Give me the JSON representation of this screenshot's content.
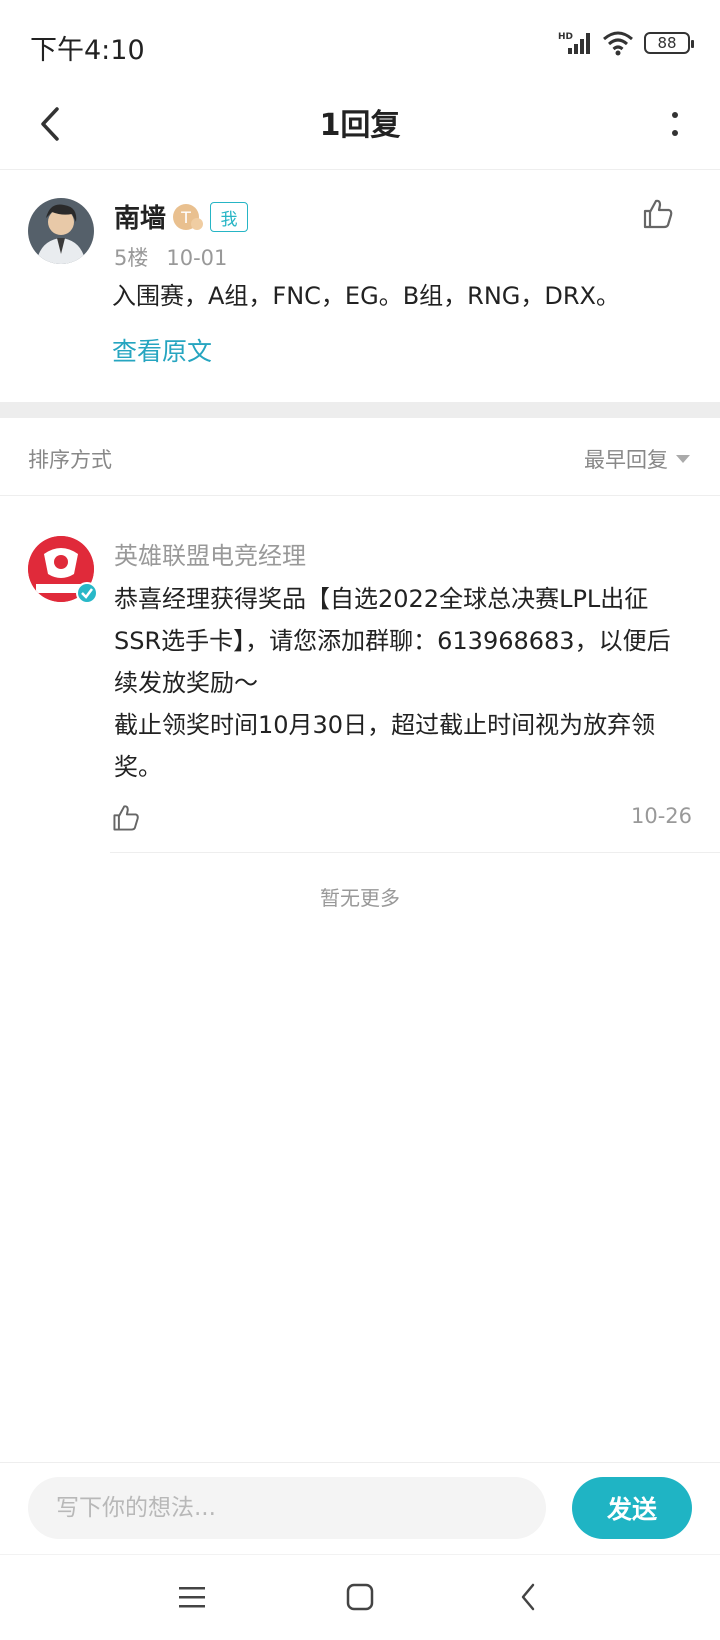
{
  "status_bar": {
    "time": "下午4:10",
    "network_label": "HD",
    "battery": "88"
  },
  "header": {
    "title": "1回复"
  },
  "post": {
    "author": "南墙",
    "level_badge": "T",
    "me_badge": "我",
    "floor": "5楼",
    "date": "10-01",
    "content": "入围赛，A组，FNC，EG。B组，RNG，DRX。",
    "view_original": "查看原文"
  },
  "sort": {
    "label": "排序方式",
    "selected": "最早回复"
  },
  "reply": {
    "author": "英雄联盟电竞经理",
    "content": "恭喜经理获得奖品【自选2022全球总决赛LPL出征SSR选手卡】，请您添加群聊：613968683，以便后续发放奖励～\n截止领奖时间10月30日，超过截止时间视为放弃领奖。",
    "date": "10-26"
  },
  "footer": {
    "no_more": "暂无更多"
  },
  "input_bar": {
    "placeholder": "写下你的想法...",
    "send_label": "发送"
  },
  "colors": {
    "accent": "#1fb4c4",
    "link": "#26a5c0",
    "divider": "#ededed"
  },
  "icons": [
    "back-arrow-icon",
    "more-vertical-icon",
    "thumbs-up-icon",
    "verified-icon",
    "menu-icon",
    "home-square-icon",
    "back-chevron-icon"
  ]
}
